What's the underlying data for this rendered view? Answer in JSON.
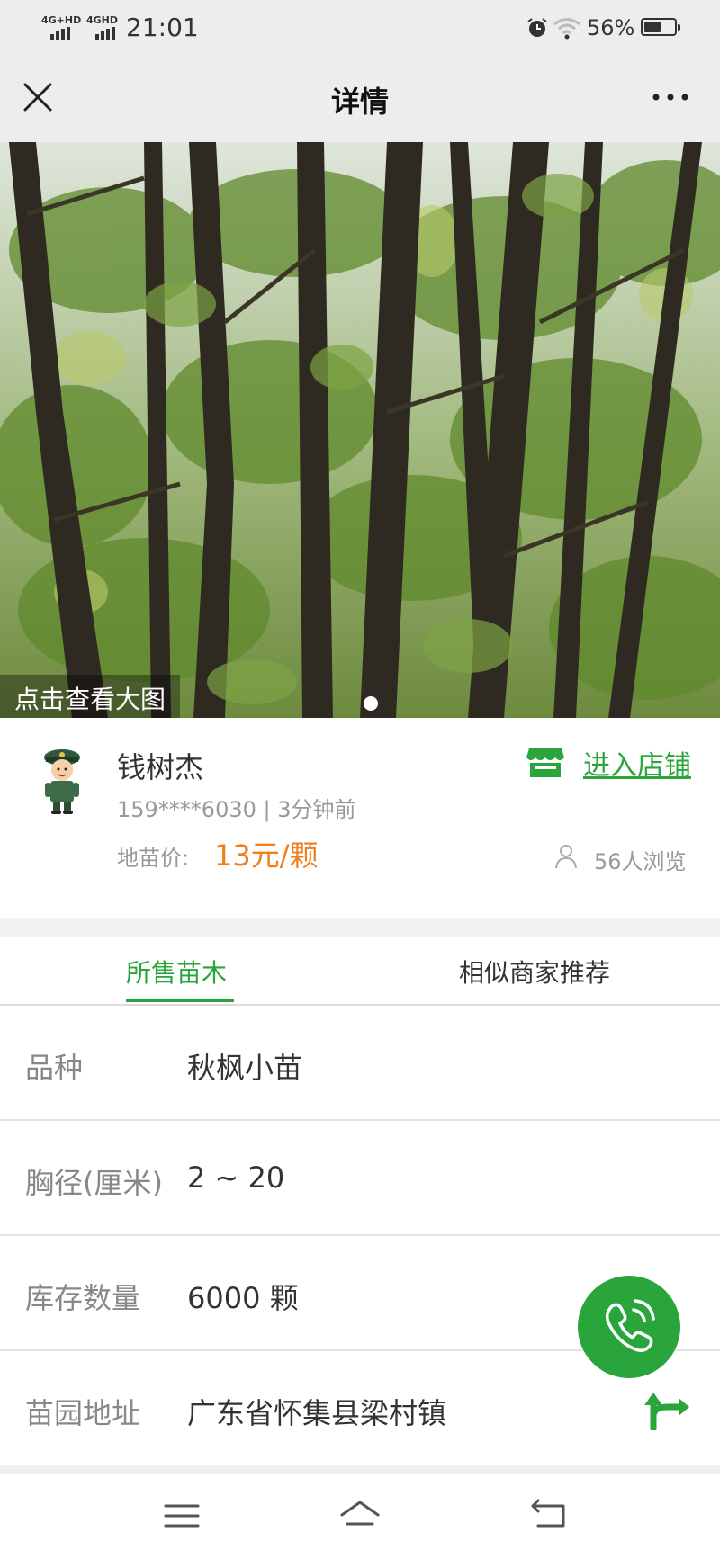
{
  "status_bar": {
    "signal1_label": "4G+HD",
    "signal2_label": "4GHD",
    "time": "21:01",
    "battery_percent": "56%",
    "battery_level": 0.56
  },
  "header": {
    "title": "详情"
  },
  "hero": {
    "caption": "点击查看大图"
  },
  "seller": {
    "name": "钱树杰",
    "meta": "159****6030  |  3分钟前",
    "price_label": "地苗价:",
    "price": "13元/颗",
    "shop_link": "进入店铺",
    "views": "56人浏览"
  },
  "tabs": [
    {
      "label": "所售苗木"
    },
    {
      "label": "相似商家推荐"
    }
  ],
  "details": [
    {
      "key": "品种",
      "value": "秋枫小苗"
    },
    {
      "key": "胸径(厘米)",
      "value": "2 ~ 20"
    },
    {
      "key": "库存数量",
      "value": "6000 颗"
    },
    {
      "key": "苗园地址",
      "value": "广东省怀集县梁村镇"
    }
  ],
  "colors": {
    "accent_green": "#2aa53b",
    "price_orange": "#f07e1a",
    "bar_bg": "#ededed"
  }
}
